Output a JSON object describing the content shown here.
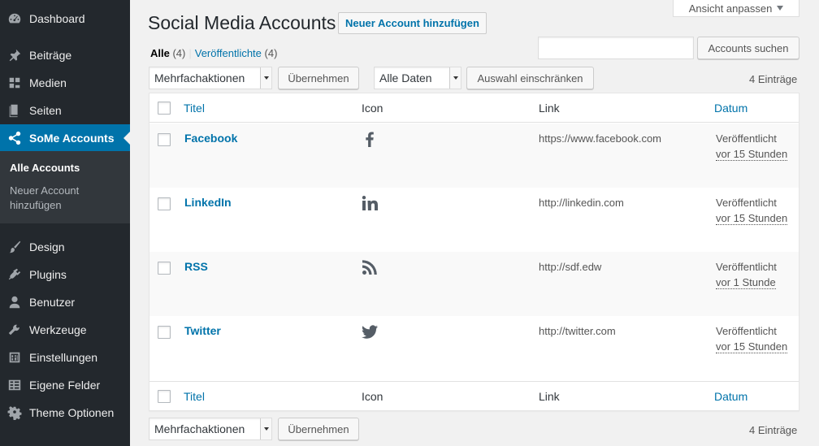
{
  "sidebar": {
    "items": [
      {
        "label": "Dashboard",
        "icon": "dashboard-icon"
      },
      {
        "label": "Beiträge",
        "icon": "pin-icon"
      },
      {
        "label": "Medien",
        "icon": "media-icon"
      },
      {
        "label": "Seiten",
        "icon": "pages-icon"
      },
      {
        "label": "SoMe Accounts",
        "icon": "share-icon"
      },
      {
        "label": "Design",
        "icon": "brush-icon"
      },
      {
        "label": "Plugins",
        "icon": "plugin-icon"
      },
      {
        "label": "Benutzer",
        "icon": "user-icon"
      },
      {
        "label": "Werkzeuge",
        "icon": "wrench-icon"
      },
      {
        "label": "Einstellungen",
        "icon": "settings-sliders-icon"
      },
      {
        "label": "Eigene Felder",
        "icon": "fields-icon"
      },
      {
        "label": "Theme Optionen",
        "icon": "gear-icon"
      }
    ],
    "submenu": {
      "current": "Alle Accounts",
      "add_new": "Neuer Account hinzufügen"
    },
    "active_color": "#0073aa"
  },
  "header": {
    "screen_options": "Ansicht anpassen",
    "title": "Social Media Accounts",
    "add_new": "Neuer Account hinzufügen"
  },
  "filters": {
    "all_label": "Alle",
    "all_count": "(4)",
    "published_label": "Veröffentlichte",
    "published_count": "(4)"
  },
  "search": {
    "value": "",
    "button": "Accounts suchen"
  },
  "tablenav_top": {
    "bulk_select": "Mehrfachaktionen",
    "apply": "Übernehmen",
    "date_select": "Alle Daten",
    "filter_button": "Auswahl einschränken",
    "items_count": "4 Einträge"
  },
  "tablenav_bottom": {
    "bulk_select": "Mehrfachaktionen",
    "apply": "Übernehmen",
    "items_count": "4 Einträge"
  },
  "table": {
    "columns": {
      "title": "Titel",
      "icon": "Icon",
      "link": "Link",
      "date": "Datum"
    },
    "rows": [
      {
        "title": "Facebook",
        "icon": "facebook-icon",
        "link": "https://www.facebook.com",
        "status": "Veröffentlicht",
        "time": "vor 15 Stunden"
      },
      {
        "title": "LinkedIn",
        "icon": "linkedin-icon",
        "link": "http://linkedin.com",
        "status": "Veröffentlicht",
        "time": "vor 15 Stunden"
      },
      {
        "title": "RSS",
        "icon": "rss-icon",
        "link": "http://sdf.edw",
        "status": "Veröffentlicht",
        "time": "vor 1 Stunde"
      },
      {
        "title": "Twitter",
        "icon": "twitter-icon",
        "link": "http://twitter.com",
        "status": "Veröffentlicht",
        "time": "vor 15 Stunden"
      }
    ]
  }
}
